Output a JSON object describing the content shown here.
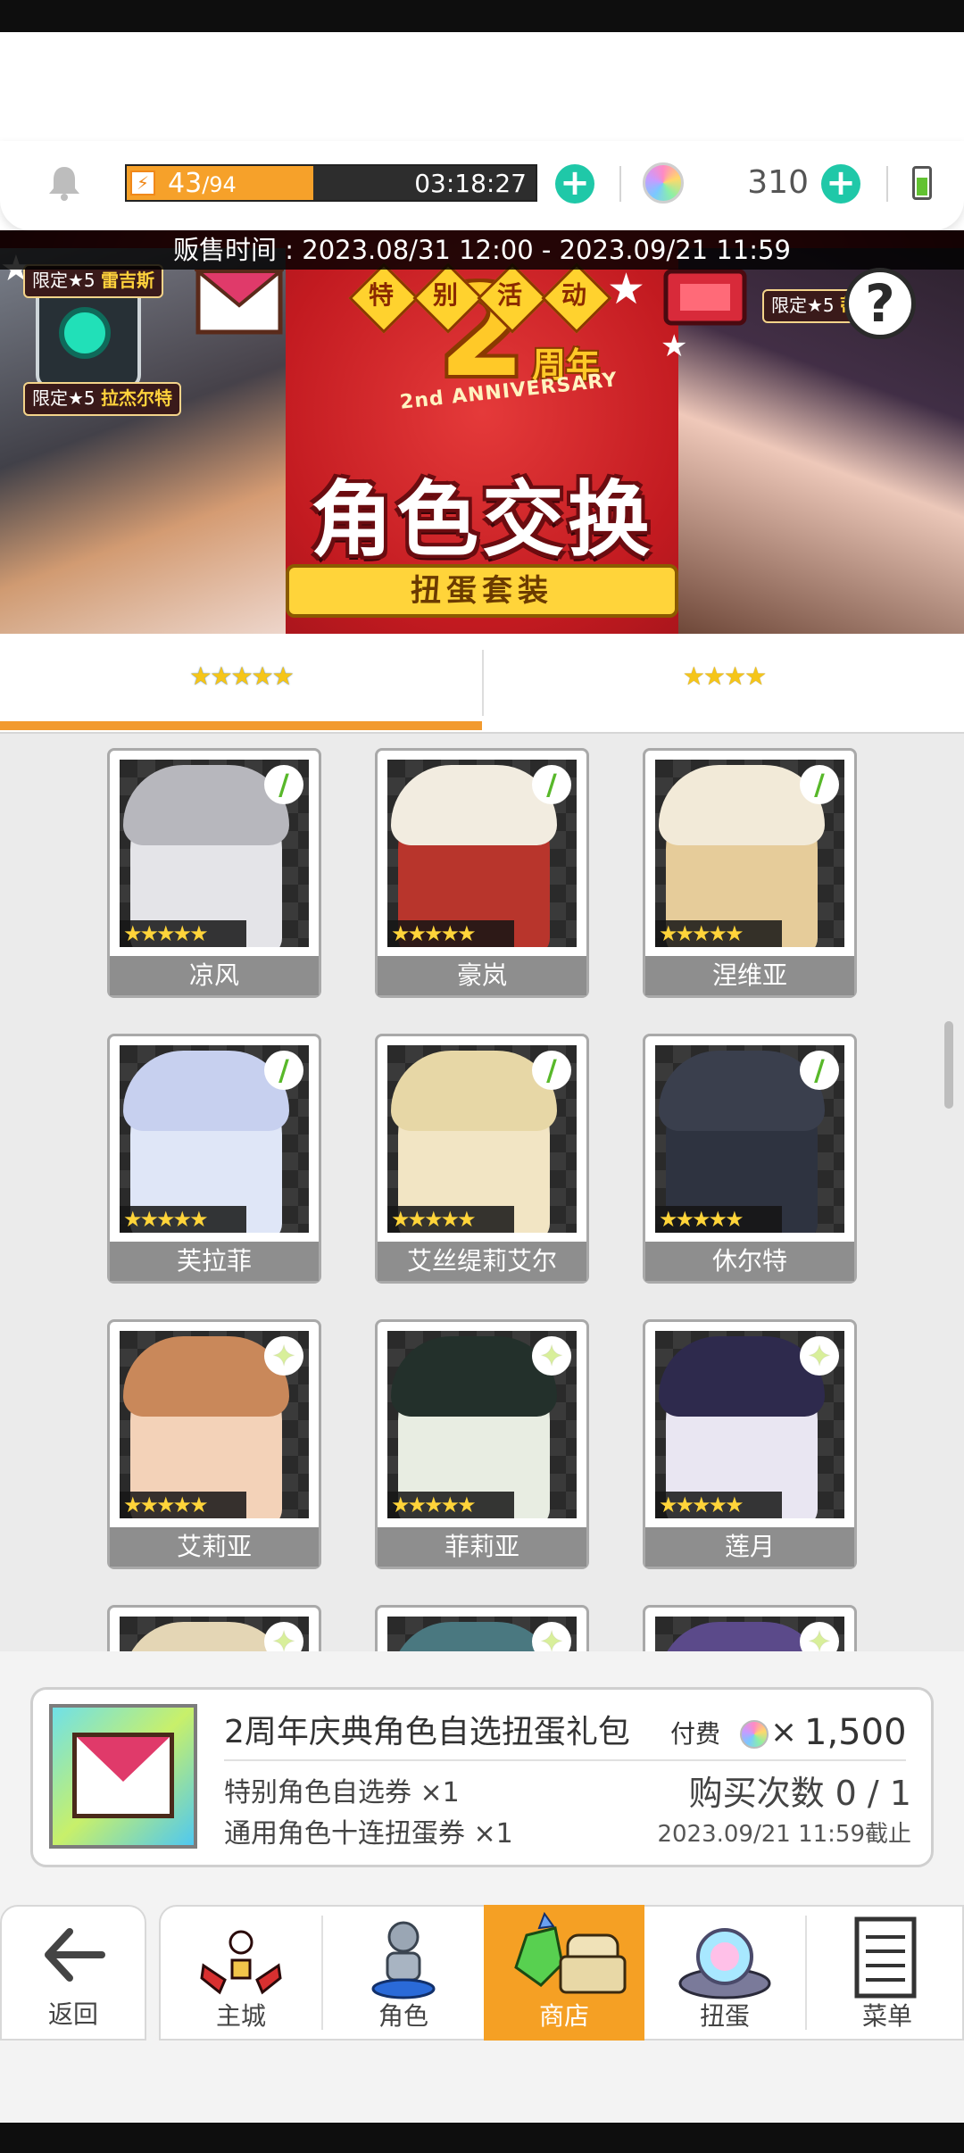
{
  "resources": {
    "stamina_current": "43",
    "stamina_max": "/94",
    "stamina_fill": 0.457,
    "stamina_timer": "03:18:27",
    "gem_count": "310"
  },
  "banner": {
    "sale_time": "贩售时间 : 2023.08/31 12:00 - 2023.09/21 11:59",
    "anniversary_number": "2",
    "anniversary_cn": "周年",
    "anniversary_en": "2nd ANNIVERSARY",
    "event_chars": [
      "特",
      "别",
      "活",
      "动"
    ],
    "title": "角色交换",
    "ribbon": "扭蛋套装",
    "tags": [
      {
        "prefix": "限定★5",
        "name": "雷吉斯"
      },
      {
        "prefix": "限定★5",
        "name": "拉杰尔特"
      },
      {
        "prefix": "限定★5",
        "name": "蒂妮"
      }
    ],
    "help_symbol": "?"
  },
  "tabs": [
    {
      "stars": "★★★★★",
      "color": "#f5c518",
      "active": true
    },
    {
      "stars": "★★★★",
      "color": "#f5c518",
      "active": false
    }
  ],
  "characters": [
    {
      "name": "凉风",
      "rarity": "★★★★★",
      "element": "wind",
      "bg": "#e4e4e8",
      "hair": "#b7b7bd"
    },
    {
      "name": "豪岚",
      "rarity": "★★★★★",
      "element": "wind",
      "bg": "#b8352c",
      "hair": "#f2ece0"
    },
    {
      "name": "涅维亚",
      "rarity": "★★★★★",
      "element": "wind",
      "bg": "#e6cc9a",
      "hair": "#f2ead8"
    },
    {
      "name": "芙拉菲",
      "rarity": "★★★★★",
      "element": "wind",
      "bg": "#dfe6f7",
      "hair": "#c7d0ef"
    },
    {
      "name": "艾丝缇莉艾尔",
      "rarity": "★★★★★",
      "element": "wind",
      "bg": "#f2e5c4",
      "hair": "#e7d7a6"
    },
    {
      "name": "休尔特",
      "rarity": "★★★★★",
      "element": "wind",
      "bg": "#2e3340",
      "hair": "#3a3f4d"
    },
    {
      "name": "艾莉亚",
      "rarity": "★★★★★",
      "element": "light",
      "bg": "#f3d2b8",
      "hair": "#c9885a"
    },
    {
      "name": "菲莉亚",
      "rarity": "★★★★★",
      "element": "light",
      "bg": "#e8ede2",
      "hair": "#23302b"
    },
    {
      "name": "莲月",
      "rarity": "★★★★★",
      "element": "light",
      "bg": "#e9e6f2",
      "hair": "#2e2a4d"
    },
    {
      "name": "",
      "rarity": "",
      "element": "light",
      "bg": "#f1ead6",
      "hair": "#e4d6b5"
    },
    {
      "name": "",
      "rarity": "",
      "element": "light",
      "bg": "#5a8a90",
      "hair": "#4a7880"
    },
    {
      "name": "",
      "rarity": "",
      "element": "light",
      "bg": "#e8dcc9",
      "hair": "#5b4a8a"
    }
  ],
  "pack": {
    "title": "2周年庆典角色自选扭蛋礼包",
    "price_label": "付费",
    "price_times": "×",
    "price_value": "1,500",
    "item1": "特别角色自选券 ×1",
    "item2": "通用角色十连扭蛋券 ×1",
    "purchase_count": "购买次数 0 / 1",
    "deadline": "2023.09/21 11:59截止"
  },
  "nav": {
    "back": {
      "label": "返回",
      "icon": "back-arrow-icon"
    },
    "items": [
      {
        "key": "main-city",
        "label": "主城",
        "icon": "castle-icon",
        "active": false
      },
      {
        "key": "character",
        "label": "角色",
        "icon": "character-icon",
        "active": false
      },
      {
        "key": "shop",
        "label": "商店",
        "icon": "shop-icon",
        "active": true
      },
      {
        "key": "gacha",
        "label": "扭蛋",
        "icon": "gacha-icon",
        "active": false
      },
      {
        "key": "menu",
        "label": "菜单",
        "icon": "menu-icon",
        "active": false
      }
    ]
  },
  "colors": {
    "accent": "#f5a024",
    "plus_button": "#1fc8a8",
    "stamina": "#f6a12a",
    "wind_element": "#58b82a",
    "light_element": "#d8ef9a"
  }
}
